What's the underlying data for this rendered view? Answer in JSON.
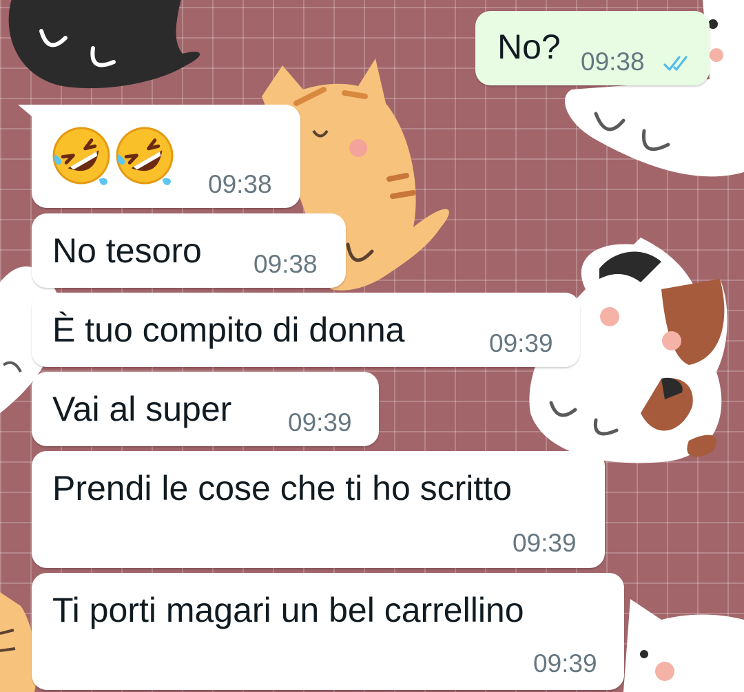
{
  "messages": [
    {
      "id": "m1",
      "direction": "outgoing",
      "text": "No?",
      "time": "09:38",
      "status": "read"
    },
    {
      "id": "m2",
      "direction": "incoming",
      "text": "",
      "emojis": [
        "rolling-on-the-floor-laughing",
        "rolling-on-the-floor-laughing"
      ],
      "time": "09:38"
    },
    {
      "id": "m3",
      "direction": "incoming",
      "text": "No tesoro",
      "time": "09:38"
    },
    {
      "id": "m4",
      "direction": "incoming",
      "text": "È tuo compito di donna",
      "time": "09:39"
    },
    {
      "id": "m5",
      "direction": "incoming",
      "text": "Vai al super",
      "time": "09:39"
    },
    {
      "id": "m6",
      "direction": "incoming",
      "text": "Prendi le cose che ti ho scritto",
      "time": "09:39"
    },
    {
      "id": "m7",
      "direction": "incoming",
      "text": "Ti porti magari un bel carrellino",
      "time": "09:39"
    }
  ],
  "colors": {
    "wallpaper": "#a2656a",
    "incoming_bubble": "#ffffff",
    "outgoing_bubble": "#e7fce3",
    "read_ticks": "#53bdeb",
    "timestamp": "#667781"
  },
  "icons": {
    "read_receipt": "double-check-icon",
    "emoji": "rolling-on-floor-laughing-emoji"
  }
}
